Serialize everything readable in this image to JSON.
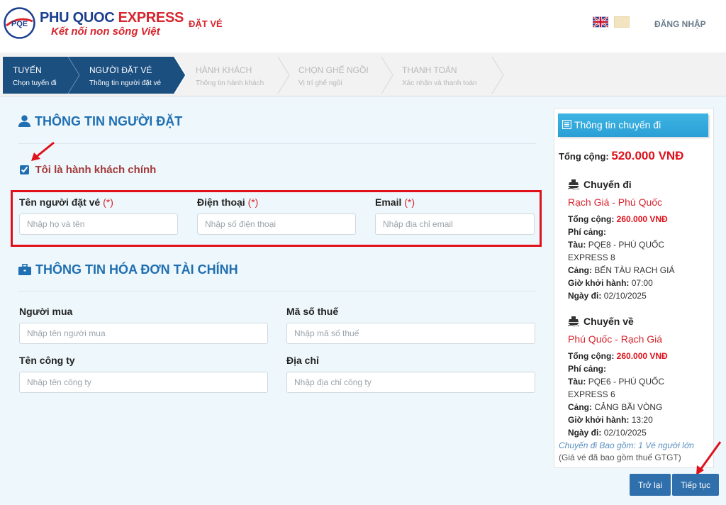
{
  "header": {
    "brand_name_a": "PHU QUOC",
    "brand_name_b": "EXPRESS",
    "brand_tagline": "Kết nối non sông Việt",
    "logo_text": "PQE",
    "nav_book": "ĐẶT VÉ",
    "login": "ĐĂNG NHẬP"
  },
  "steps": [
    {
      "title": "TUYẾN",
      "subtitle": "Chọn tuyến đi",
      "state": "done"
    },
    {
      "title": "NGƯỜI ĐẶT VÉ",
      "subtitle": "Thông tin người đặt vé",
      "state": "active"
    },
    {
      "title": "HÀNH KHÁCH",
      "subtitle": "Thông tin hành khách",
      "state": "inactive"
    },
    {
      "title": "CHỌN GHẾ NGỒI",
      "subtitle": "Vị trí ghế ngồi",
      "state": "inactive"
    },
    {
      "title": "THANH TOÁN",
      "subtitle": "Xác nhận và thanh toán",
      "state": "inactive"
    }
  ],
  "booker": {
    "section_title": "THÔNG TIN NGƯỜI ĐẶT",
    "is_main_passenger_label": "Tôi là hành khách chính",
    "is_main_passenger_checked": true,
    "required_mark": "(*)",
    "name_label": "Tên người đặt vé",
    "name_placeholder": "Nhập họ và tên",
    "phone_label": "Điện thoại",
    "phone_placeholder": "Nhập số điện thoại",
    "email_label": "Email",
    "email_placeholder": "Nhập địa chỉ email"
  },
  "invoice": {
    "section_title": "THÔNG TIN HÓA ĐƠN TÀI CHÍNH",
    "buyer_label": "Người mua",
    "buyer_placeholder": "Nhập tên người mua",
    "tax_label": "Mã số thuế",
    "tax_placeholder": "Nhập mã số thuế",
    "company_label": "Tên công ty",
    "company_placeholder": "Nhập tên công ty",
    "address_label": "Địa chỉ",
    "address_placeholder": "Nhập địa chỉ công ty"
  },
  "sidebar": {
    "title": "Thông tin chuyến đi",
    "total_label": "Tổng cộng:",
    "total_amount": "520.000 VNĐ",
    "outbound": {
      "heading": "Chuyến đi",
      "route": "Rạch Giá - Phú Quốc",
      "total_label": "Tổng cộng:",
      "total_value": "260.000 VNĐ",
      "fee_label": "Phí cảng:",
      "ship_label": "Tàu:",
      "ship_value": "PQE8 - PHÚ QUỐC EXPRESS 8",
      "port_label": "Cảng:",
      "port_value": "BẾN TÀU RẠCH GIÁ",
      "depart_label": "Giờ khởi hành:",
      "depart_value": "07:00",
      "date_label": "Ngày đi:",
      "date_value": "02/10/2025"
    },
    "return": {
      "heading": "Chuyến về",
      "route": "Phú Quốc - Rạch Giá",
      "total_label": "Tổng cộng:",
      "total_value": "260.000 VNĐ",
      "fee_label": "Phí cảng:",
      "ship_label": "Tàu:",
      "ship_value": "PQE6 - PHÚ QUỐC EXPRESS 6",
      "port_label": "Cảng:",
      "port_value": "CẢNG BÃI VÒNG",
      "depart_label": "Giờ khởi hành:",
      "depart_value": "13:20",
      "date_label": "Ngày đi:",
      "date_value": "02/10/2025"
    },
    "note_italic": "Chuyến đi Bao gồm: 1 Vé người lớn",
    "note_plain": "(Giá vé đã bao gồm thuế GTGT)"
  },
  "buttons": {
    "back": "Trở lại",
    "next": "Tiếp tục"
  },
  "colors": {
    "primary": "#1f6fb2",
    "brand_red": "#d7262e",
    "highlight": "#e0111b",
    "step_active": "#1b4f80"
  }
}
